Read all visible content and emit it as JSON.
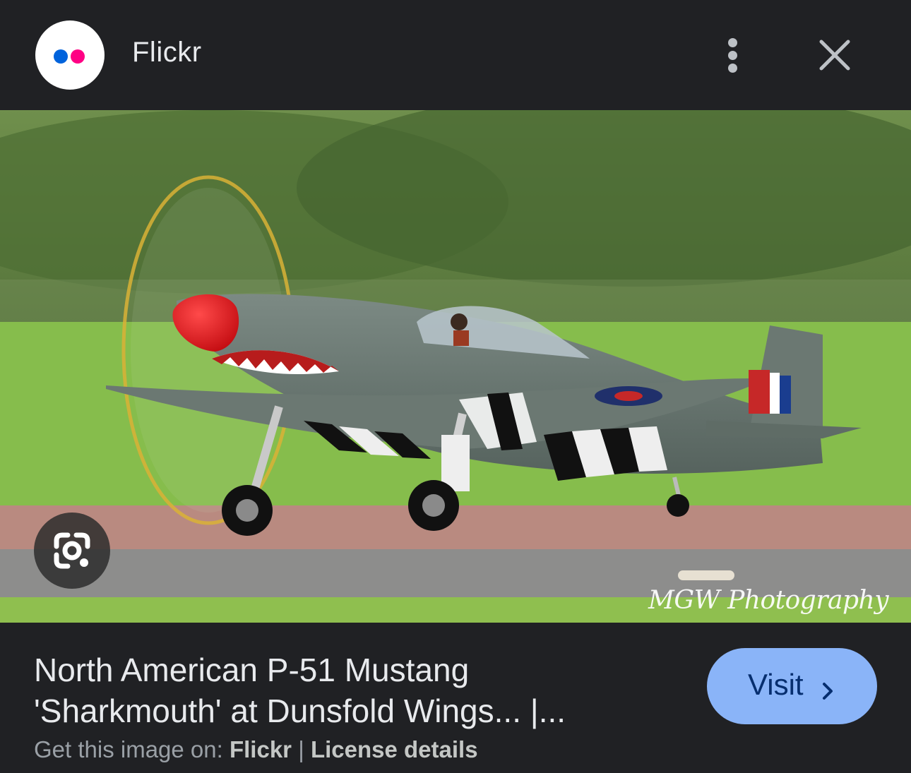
{
  "header": {
    "site_name": "Flickr",
    "logo_icon": "flickr-logo-icon",
    "more_icon": "more-vert-icon",
    "close_icon": "close-icon"
  },
  "image": {
    "description_icon": "photo-preview",
    "watermark": "MGW Photography",
    "lens_icon": "google-lens-icon"
  },
  "result": {
    "title_line1": "North American P-51 Mustang",
    "title_line2": "'Sharkmouth' at Dunsfold Wings... |...",
    "source_prefix": "Get this image on: ",
    "source_name": "Flickr",
    "separator": " | ",
    "license_label": "License details",
    "visit_label": "Visit",
    "visit_icon": "chevron-right-icon"
  },
  "colors": {
    "background": "#202124",
    "visit_button": "#8ab4f8",
    "flickr_blue": "#0063dc",
    "flickr_pink": "#ff0084"
  }
}
